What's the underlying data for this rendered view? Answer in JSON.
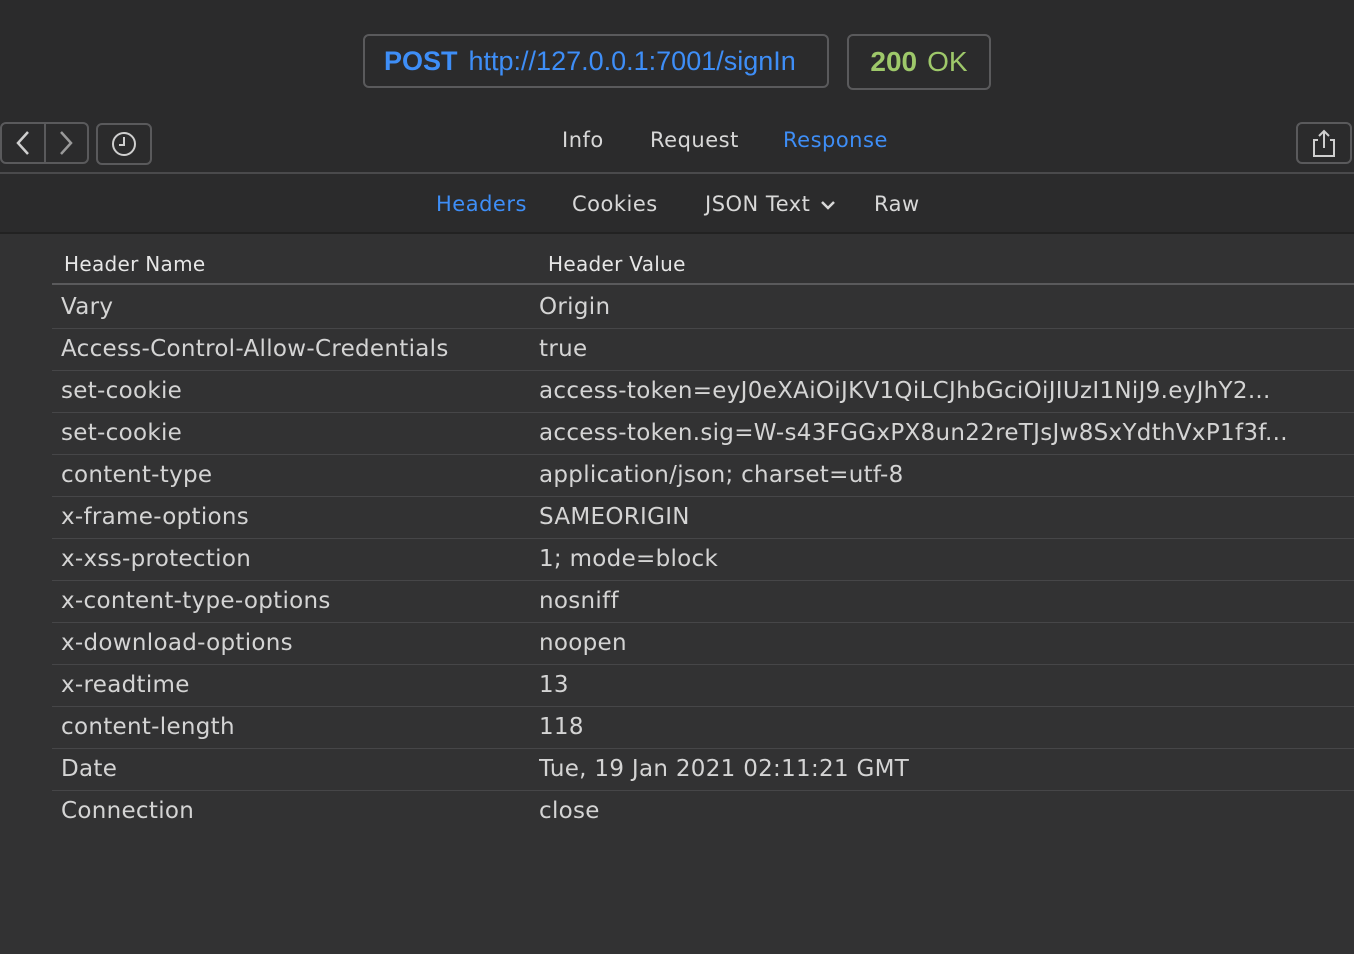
{
  "request": {
    "method": "POST",
    "url": "http://127.0.0.1:7001/signIn"
  },
  "response_status": {
    "code": "200",
    "text": "OK"
  },
  "toolbar": {
    "back_icon": "chevron-left-icon",
    "forward_icon": "chevron-right-icon",
    "history_icon": "clock-icon",
    "share_icon": "share-icon"
  },
  "main_tabs": [
    {
      "label": "Info",
      "active": false
    },
    {
      "label": "Request",
      "active": false
    },
    {
      "label": "Response",
      "active": true
    }
  ],
  "sub_tabs": [
    {
      "label": "Headers",
      "active": true
    },
    {
      "label": "Cookies",
      "active": false
    },
    {
      "label": "JSON Text",
      "active": false,
      "dropdown": true
    },
    {
      "label": "Raw",
      "active": false
    }
  ],
  "table": {
    "columns": [
      "Header Name",
      "Header Value"
    ],
    "rows": [
      {
        "name": "Vary",
        "value": "Origin"
      },
      {
        "name": "Access-Control-Allow-Credentials",
        "value": "true"
      },
      {
        "name": "set-cookie",
        "value": "access-token=eyJ0eXAiOiJKV1QiLCJhbGciOiJIUzI1NiJ9.eyJhY2..."
      },
      {
        "name": "set-cookie",
        "value": "access-token.sig=W-s43FGGxPX8un22reTJsJw8SxYdthVxP1f3f..."
      },
      {
        "name": "content-type",
        "value": "application/json; charset=utf-8"
      },
      {
        "name": "x-frame-options",
        "value": "SAMEORIGIN"
      },
      {
        "name": "x-xss-protection",
        "value": "1; mode=block"
      },
      {
        "name": "x-content-type-options",
        "value": "nosniff"
      },
      {
        "name": "x-download-options",
        "value": "noopen"
      },
      {
        "name": "x-readtime",
        "value": "13"
      },
      {
        "name": "content-length",
        "value": "118"
      },
      {
        "name": "Date",
        "value": "Tue, 19 Jan 2021 02:11:21 GMT"
      },
      {
        "name": "Connection",
        "value": "close"
      }
    ]
  },
  "colors": {
    "accent": "#3e8ef7",
    "status_ok": "#9ec86a",
    "background": "#323233"
  }
}
